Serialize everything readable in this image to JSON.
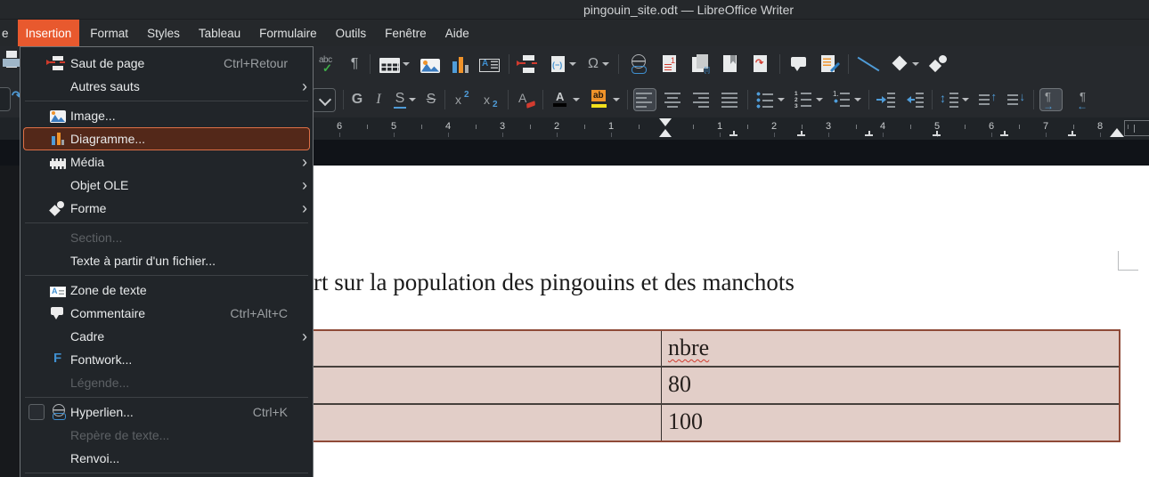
{
  "window": {
    "title": "pingouin_site.odt — LibreOffice Writer"
  },
  "menubar": {
    "clipped_item_fragment": "e",
    "items": [
      {
        "label": "Insertion",
        "active": true
      },
      {
        "label": "Format"
      },
      {
        "label": "Styles"
      },
      {
        "label": "Tableau"
      },
      {
        "label": "Formulaire"
      },
      {
        "label": "Outils"
      },
      {
        "label": "Fenêtre"
      },
      {
        "label": "Aide"
      }
    ]
  },
  "insertion_menu": {
    "items": [
      {
        "label": "Saut de page",
        "shortcut": "Ctrl+Retour",
        "icon": "page-break-icon"
      },
      {
        "label": "Autres sauts",
        "submenu": true,
        "sep_after": true
      },
      {
        "label": "Image...",
        "icon": "image-icon"
      },
      {
        "label": "Diagramme...",
        "icon": "chart-icon",
        "highlighted": true
      },
      {
        "label": "Média",
        "icon": "media-icon",
        "submenu": true
      },
      {
        "label": "Objet OLE",
        "submenu": true
      },
      {
        "label": "Forme",
        "icon": "shape-icon",
        "submenu": true,
        "sep_after": true
      },
      {
        "label": "Section...",
        "disabled": true
      },
      {
        "label": "Texte à partir d'un fichier...",
        "sep_after": true
      },
      {
        "label": "Zone de texte",
        "icon": "textbox-icon"
      },
      {
        "label": "Commentaire",
        "shortcut": "Ctrl+Alt+C",
        "icon": "comment-icon"
      },
      {
        "label": "Cadre",
        "submenu": true
      },
      {
        "label": "Fontwork...",
        "icon": "fontwork-icon"
      },
      {
        "label": "Légende...",
        "disabled": true,
        "sep_after": true
      },
      {
        "label": "Hyperlien...",
        "shortcut": "Ctrl+K",
        "icon": "hyperlink-icon",
        "checkbox": true
      },
      {
        "label": "Repère de texte...",
        "disabled": true
      },
      {
        "label": "Renvoi...",
        "sep_after": true
      }
    ]
  },
  "toolbar_standard": {
    "items": [
      {
        "sep": true
      },
      {
        "name": "spellcheck-icon",
        "cls": "ic-spell"
      },
      {
        "name": "formatting-marks-icon",
        "glyph": "¶"
      },
      {
        "sep": true
      },
      {
        "name": "insert-table-icon",
        "cls": "ic-table",
        "dd": true
      },
      {
        "name": "insert-image-icon",
        "cls": "ic-image"
      },
      {
        "name": "insert-chart-icon",
        "cls": "ic-chart"
      },
      {
        "name": "insert-textbox-icon",
        "cls": "ic-textbox"
      },
      {
        "sep": true
      },
      {
        "name": "page-break-icon",
        "cls": "ic-pagebreak"
      },
      {
        "name": "insert-field-icon",
        "cls": "ic-field",
        "dd": true
      },
      {
        "name": "special-character-icon",
        "glyph": "Ω",
        "dd": true
      },
      {
        "sep": true
      },
      {
        "name": "hyperlink-icon",
        "cls": "ic-hyperlink"
      },
      {
        "name": "footnote-icon",
        "cls": "ic-footnote"
      },
      {
        "name": "index-entry-icon",
        "cls": "ic-index"
      },
      {
        "name": "bookmark-icon",
        "cls": "ic-bookmark"
      },
      {
        "name": "cross-reference-icon",
        "cls": "ic-crossref"
      },
      {
        "sep": true
      },
      {
        "name": "comment-icon",
        "cls": "ic-comment"
      },
      {
        "name": "track-changes-icon",
        "cls": "ic-track"
      },
      {
        "sep": true
      },
      {
        "name": "insert-line-icon",
        "cls": "ic-line"
      },
      {
        "name": "basic-shapes-icon",
        "cls": "ic-diamond",
        "dd": true
      },
      {
        "name": "more-shapes-icon",
        "cls": "ic-shapes"
      }
    ]
  },
  "toolbar_formatting": {
    "items": [
      {
        "name": "font-size-dropdown-icon",
        "cls": "ic-combo"
      },
      {
        "sep": true
      },
      {
        "name": "bold-icon",
        "glyph": "G",
        "gcls": "g-bold"
      },
      {
        "name": "italic-icon",
        "glyph": "I",
        "gcls": "g-italic"
      },
      {
        "name": "underline-icon",
        "glyph": "S",
        "gcls": "g-underline",
        "dd": true
      },
      {
        "name": "strikethrough-icon",
        "glyph": "S",
        "gcls": "g-strike"
      },
      {
        "sep": true
      },
      {
        "name": "superscript-icon",
        "cls": "ic-sup"
      },
      {
        "name": "subscript-icon",
        "cls": "ic-sub"
      },
      {
        "sep": true
      },
      {
        "name": "clear-formatting-icon",
        "cls": "ic-clear"
      },
      {
        "sep": true
      },
      {
        "name": "font-color-icon",
        "cls": "ic-fontcolor",
        "dd": true
      },
      {
        "name": "highlight-color-icon",
        "cls": "ic-highlight",
        "dd": true
      },
      {
        "sep": true
      },
      {
        "name": "align-left-icon",
        "cls": "al ic-al-left",
        "pressed": true
      },
      {
        "name": "align-center-icon",
        "cls": "al ic-al-center"
      },
      {
        "name": "align-right-icon",
        "cls": "al ic-al-right"
      },
      {
        "name": "justify-icon",
        "cls": "al ic-al-just"
      },
      {
        "sep": true
      },
      {
        "name": "bullet-list-icon",
        "cls": "ic-bullets",
        "dd": true
      },
      {
        "name": "numbered-list-icon",
        "cls": "ic-numbered",
        "dd": true
      },
      {
        "name": "outline-list-icon",
        "cls": "ic-outline",
        "dd": true
      },
      {
        "sep": true
      },
      {
        "name": "increase-indent-icon",
        "cls": "ic-ind-inc"
      },
      {
        "name": "decrease-indent-icon",
        "cls": "ic-ind-dec"
      },
      {
        "sep": true
      },
      {
        "name": "line-spacing-icon",
        "cls": "ic-linespace",
        "dd": true
      },
      {
        "name": "space-above-icon",
        "cls": "ic-sp-above"
      },
      {
        "name": "space-below-icon",
        "cls": "ic-sp-below"
      },
      {
        "sep": true
      },
      {
        "name": "left-to-right-icon",
        "cls": "ic-ltr",
        "pressed": true
      },
      {
        "name": "right-to-left-icon",
        "cls": "ic-rtl"
      }
    ]
  },
  "ruler": {
    "left_numbers": [
      "6",
      "5",
      "4",
      "3",
      "2",
      "1"
    ],
    "right_numbers": [
      "1",
      "2",
      "3",
      "4",
      "5",
      "6",
      "7",
      "8"
    ]
  },
  "document": {
    "heading_visible_text": "rt sur la population des pingouins et des manchots",
    "table": {
      "header": [
        "",
        "nbre"
      ],
      "rows": [
        [
          "",
          "80"
        ],
        [
          "",
          "100"
        ]
      ],
      "misspelled_word": "nbre"
    }
  },
  "colors": {
    "menu_accent": "#e8592e",
    "highlighted_item_border": "#dd7046",
    "table_fill": "#e2cec8",
    "font_color_swatch": "#000000",
    "highlight_swatch": "#f3e11c"
  }
}
